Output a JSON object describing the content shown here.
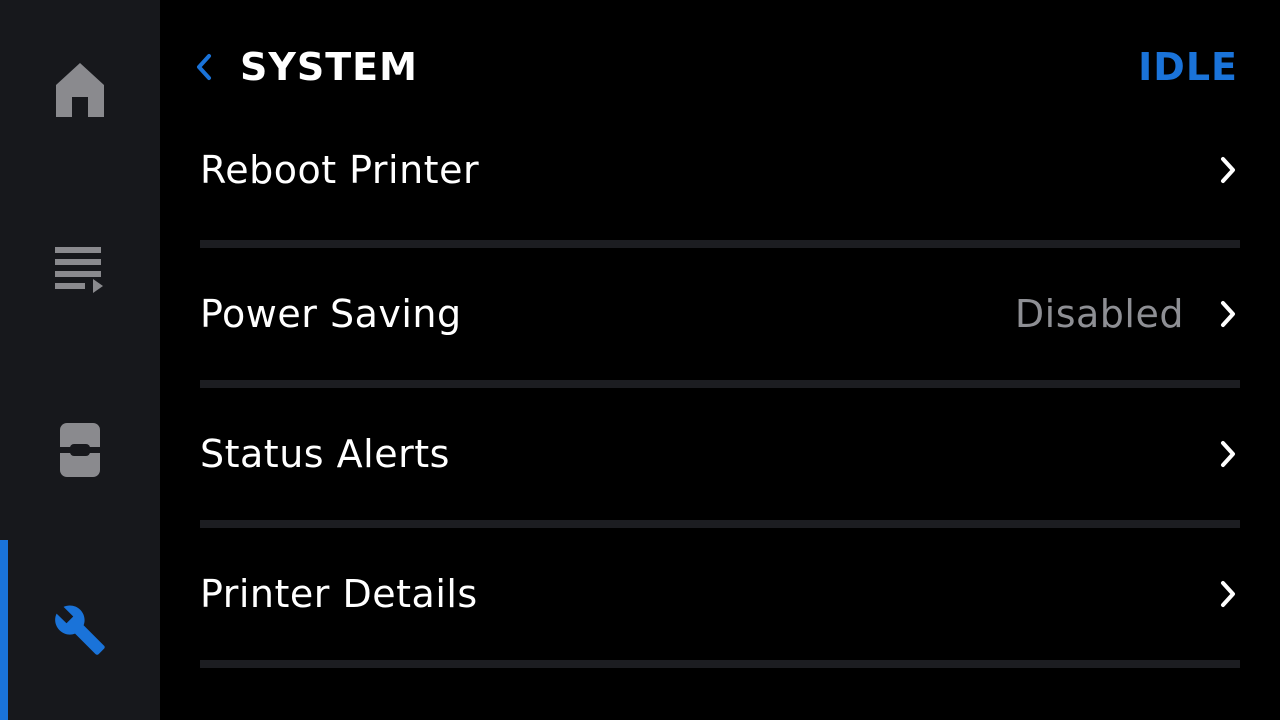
{
  "colors": {
    "accent": "#1a73d9",
    "sidebar_bg": "#17181c",
    "icon_inactive": "#8a8a8e",
    "divider": "#1c1d21",
    "value_text": "#8e8f94"
  },
  "sidebar": {
    "items": [
      {
        "icon": "home-icon",
        "active": false
      },
      {
        "icon": "queue-list-icon",
        "active": false
      },
      {
        "icon": "printer-icon",
        "active": false
      },
      {
        "icon": "wrench-icon",
        "active": true
      }
    ]
  },
  "header": {
    "back_icon": "chevron-left-icon",
    "title": "SYSTEM",
    "status": "IDLE"
  },
  "menu": {
    "items": [
      {
        "label": "Reboot Printer",
        "value": ""
      },
      {
        "label": "Power Saving",
        "value": "Disabled"
      },
      {
        "label": "Status Alerts",
        "value": ""
      },
      {
        "label": "Printer Details",
        "value": ""
      }
    ],
    "chevron_icon": "chevron-right-icon"
  }
}
